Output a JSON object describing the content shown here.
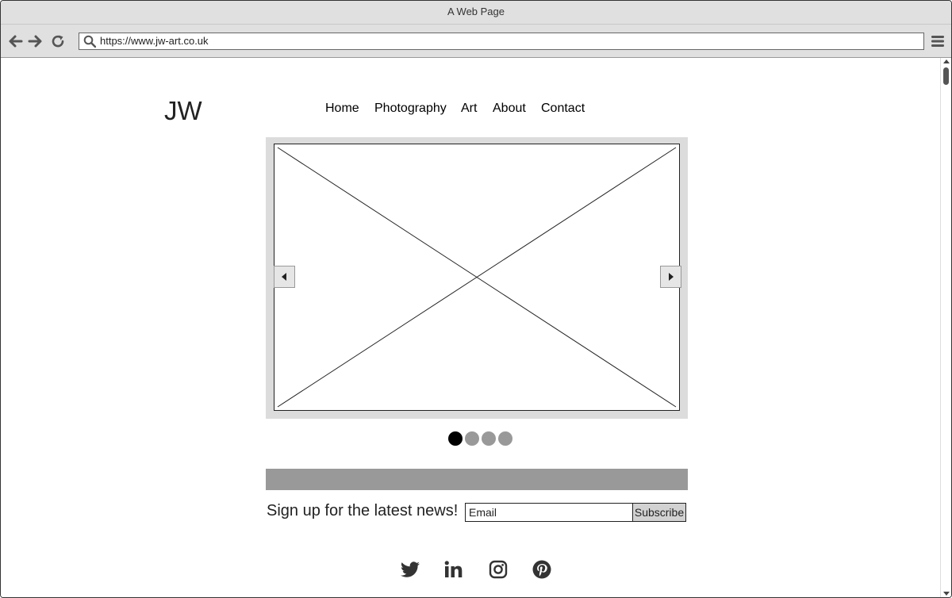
{
  "browser": {
    "window_title": "A Web Page",
    "url": "https://www.jw-art.co.uk"
  },
  "site": {
    "logo": "JW",
    "nav": [
      {
        "label": "Home"
      },
      {
        "label": "Photography"
      },
      {
        "label": "Art"
      },
      {
        "label": "About"
      },
      {
        "label": "Contact"
      }
    ]
  },
  "carousel": {
    "slide_count": 4,
    "active_slide": 1,
    "prev_icon": "triangle-left-icon",
    "next_icon": "triangle-right-icon"
  },
  "signup": {
    "text": "Sign up for the latest news!",
    "email_placeholder": "Email",
    "subscribe_label": "Subscribe"
  },
  "social": [
    {
      "name": "twitter-icon"
    },
    {
      "name": "linkedin-icon"
    },
    {
      "name": "instagram-icon"
    },
    {
      "name": "pinterest-icon"
    }
  ],
  "colors": {
    "chrome": "#e0e0e0",
    "carousel_frame": "#dcdcdc",
    "banner": "#999999",
    "dot_active": "#000000",
    "dot_inactive": "#999999",
    "subscribe_button": "#d2d2d2",
    "icon": "#333333"
  }
}
